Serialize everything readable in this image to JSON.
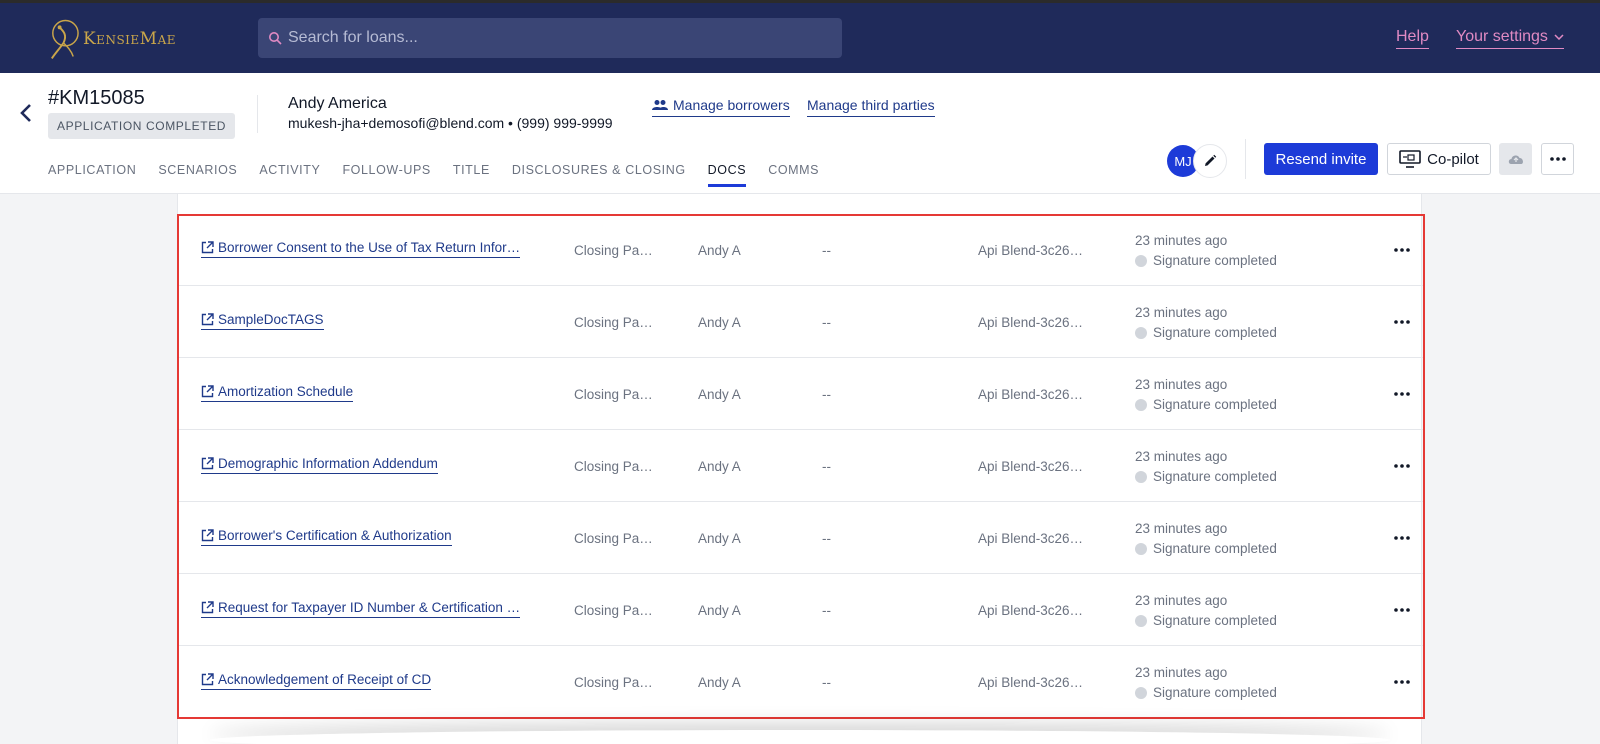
{
  "app": {
    "brand": "KensieMae",
    "search_placeholder": "Search for loans...",
    "help_label": "Help",
    "settings_label": "Your settings"
  },
  "loan": {
    "id": "#KM15085",
    "status": "APPLICATION COMPLETED",
    "borrower_name": "Andy America",
    "borrower_contact": "mukesh-jha+demosofi@blend.com • (999) 999-9999",
    "manage_borrowers": "Manage borrowers",
    "manage_third_parties": "Manage third parties"
  },
  "tabs": [
    {
      "label": "APPLICATION",
      "active": false
    },
    {
      "label": "SCENARIOS",
      "active": false
    },
    {
      "label": "ACTIVITY",
      "active": false
    },
    {
      "label": "FOLLOW-UPS",
      "active": false
    },
    {
      "label": "TITLE",
      "active": false
    },
    {
      "label": "DISCLOSURES & CLOSING",
      "active": false
    },
    {
      "label": "DOCS",
      "active": true
    },
    {
      "label": "COMMS",
      "active": false
    }
  ],
  "actions": {
    "avatar_initials": "MJ",
    "resend_invite": "Resend invite",
    "copilot": "Co-pilot"
  },
  "docs": [
    {
      "name": "Borrower Consent to the Use of Tax Return Infor…",
      "package": "Closing Pa…",
      "assignee": "Andy A",
      "extra": "--",
      "source": "Api Blend-3c26…",
      "time": "23 minutes ago",
      "status": "Signature completed"
    },
    {
      "name": "SampleDocTAGS",
      "package": "Closing Pa…",
      "assignee": "Andy A",
      "extra": "--",
      "source": "Api Blend-3c26…",
      "time": "23 minutes ago",
      "status": "Signature completed"
    },
    {
      "name": "Amortization Schedule",
      "package": "Closing Pa…",
      "assignee": "Andy A",
      "extra": "--",
      "source": "Api Blend-3c26…",
      "time": "23 minutes ago",
      "status": "Signature completed"
    },
    {
      "name": "Demographic Information Addendum",
      "package": "Closing Pa…",
      "assignee": "Andy A",
      "extra": "--",
      "source": "Api Blend-3c26…",
      "time": "23 minutes ago",
      "status": "Signature completed"
    },
    {
      "name": "Borrower's Certification & Authorization",
      "package": "Closing Pa…",
      "assignee": "Andy A",
      "extra": "--",
      "source": "Api Blend-3c26…",
      "time": "23 minutes ago",
      "status": "Signature completed"
    },
    {
      "name": "Request for Taxpayer ID Number & Certification …",
      "package": "Closing Pa…",
      "assignee": "Andy A",
      "extra": "--",
      "source": "Api Blend-3c26…",
      "time": "23 minutes ago",
      "status": "Signature completed"
    },
    {
      "name": "Acknowledgement of Receipt of CD",
      "package": "Closing Pa…",
      "assignee": "Andy A",
      "extra": "--",
      "source": "Api Blend-3c26…",
      "time": "23 minutes ago",
      "status": "Signature completed"
    }
  ],
  "colors": {
    "navbar": "#1f2a5a",
    "accent": "#1d3bd8",
    "link": "#1f3a8a",
    "top_link": "#e08ac3",
    "highlight": "#e53935"
  }
}
